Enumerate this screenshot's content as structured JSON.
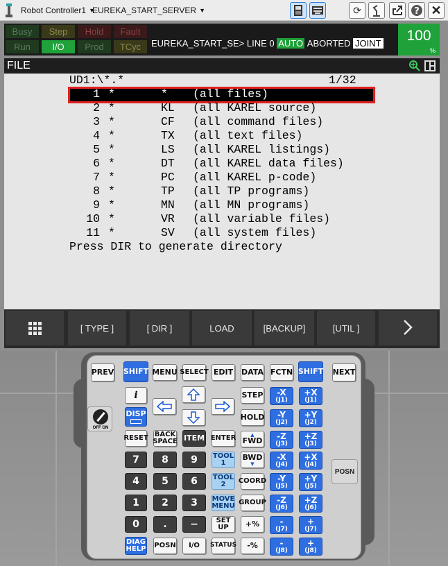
{
  "toolbar": {
    "controller": "Robot Controller1",
    "program": "EUREKA_START_SERVER"
  },
  "status": {
    "leds": [
      "Busy",
      "Step",
      "Hold",
      "Fault",
      "Run",
      "I/O",
      "Prod",
      "TCyc"
    ],
    "program_name": "EUREKA_START_SE>",
    "line_label": "LINE 0",
    "mode": "AUTO",
    "state": "ABORTED",
    "coord": "JOINT",
    "speed": "100",
    "speed_unit": "%"
  },
  "screen": {
    "title": "FILE",
    "path": "UD1:\\*.*",
    "page": "1/32",
    "rows": [
      {
        "num": "1",
        "star": "*",
        "ext": "*",
        "desc": "(all files)"
      },
      {
        "num": "2",
        "star": "*",
        "ext": "KL",
        "desc": "(all KAREL source)"
      },
      {
        "num": "3",
        "star": "*",
        "ext": "CF",
        "desc": "(all command files)"
      },
      {
        "num": "4",
        "star": "*",
        "ext": "TX",
        "desc": "(all text files)"
      },
      {
        "num": "5",
        "star": "*",
        "ext": "LS",
        "desc": "(all KAREL listings)"
      },
      {
        "num": "6",
        "star": "*",
        "ext": "DT",
        "desc": "(all KAREL data files)"
      },
      {
        "num": "7",
        "star": "*",
        "ext": "PC",
        "desc": "(all KAREL p-code)"
      },
      {
        "num": "8",
        "star": "*",
        "ext": "TP",
        "desc": "(all TP programs)"
      },
      {
        "num": "9",
        "star": "*",
        "ext": "MN",
        "desc": "(all MN programs)"
      },
      {
        "num": "10",
        "star": "*",
        "ext": "VR",
        "desc": "(all variable files)"
      },
      {
        "num": "11",
        "star": "*",
        "ext": "SV",
        "desc": "(all system files)"
      }
    ],
    "hint": "Press DIR to generate directory"
  },
  "fkeys": [
    "[ TYPE ]",
    "[ DIR ]",
    "LOAD",
    "[BACKUP]",
    "[UTIL ]"
  ],
  "pendant": {
    "prev": "PREV",
    "shift": "SHIFT",
    "menu": "MENU",
    "select": "SELECT",
    "edit": "EDIT",
    "data": "DATA",
    "fctn": "FCTN",
    "next": "NEXT",
    "info": "i",
    "disp": "DISP",
    "reset": "RESET",
    "back1": "BACK",
    "back2": "SPACE",
    "item": "ITEM",
    "enter": "ENTER",
    "step": "STEP",
    "hold": "HOLD",
    "fwd": "FWD",
    "bwd": "BWD",
    "coord": "COORD",
    "group": "GROUP",
    "tool1a": "TOOL",
    "tool1b": "1",
    "tool2a": "TOOL",
    "tool2b": "2",
    "move1": "MOVE",
    "move2": "MENU",
    "set1": "SET",
    "set2": "UP",
    "diag1": "DIAG",
    "diag2": "HELP",
    "posn": "POSN",
    "io": "I/O",
    "status": "STATUS",
    "digits": [
      "7",
      "8",
      "9",
      "4",
      "5",
      "6",
      "1",
      "2",
      "3",
      "0",
      ".",
      "−"
    ],
    "plus_pct": "+%",
    "minus_pct": "-%",
    "onoff": "OFF ON",
    "jog": [
      [
        "-X",
        "(J1)",
        "+X",
        "(J1)"
      ],
      [
        "-Y",
        "(J2)",
        "+Y",
        "(J2)"
      ],
      [
        "-Z",
        "(J3)",
        "+Z",
        "(J3)"
      ],
      [
        "-X",
        "(J4)",
        "+X",
        "(J4)"
      ],
      [
        "-Y",
        "(J5)",
        "+Y",
        "(J5)"
      ],
      [
        "-Z",
        "(J6)",
        "+Z",
        "(J6)"
      ],
      [
        "-",
        "(J7)",
        "+",
        "(J7)"
      ],
      [
        "-",
        "(J8)",
        "+",
        "(J8)"
      ]
    ]
  }
}
